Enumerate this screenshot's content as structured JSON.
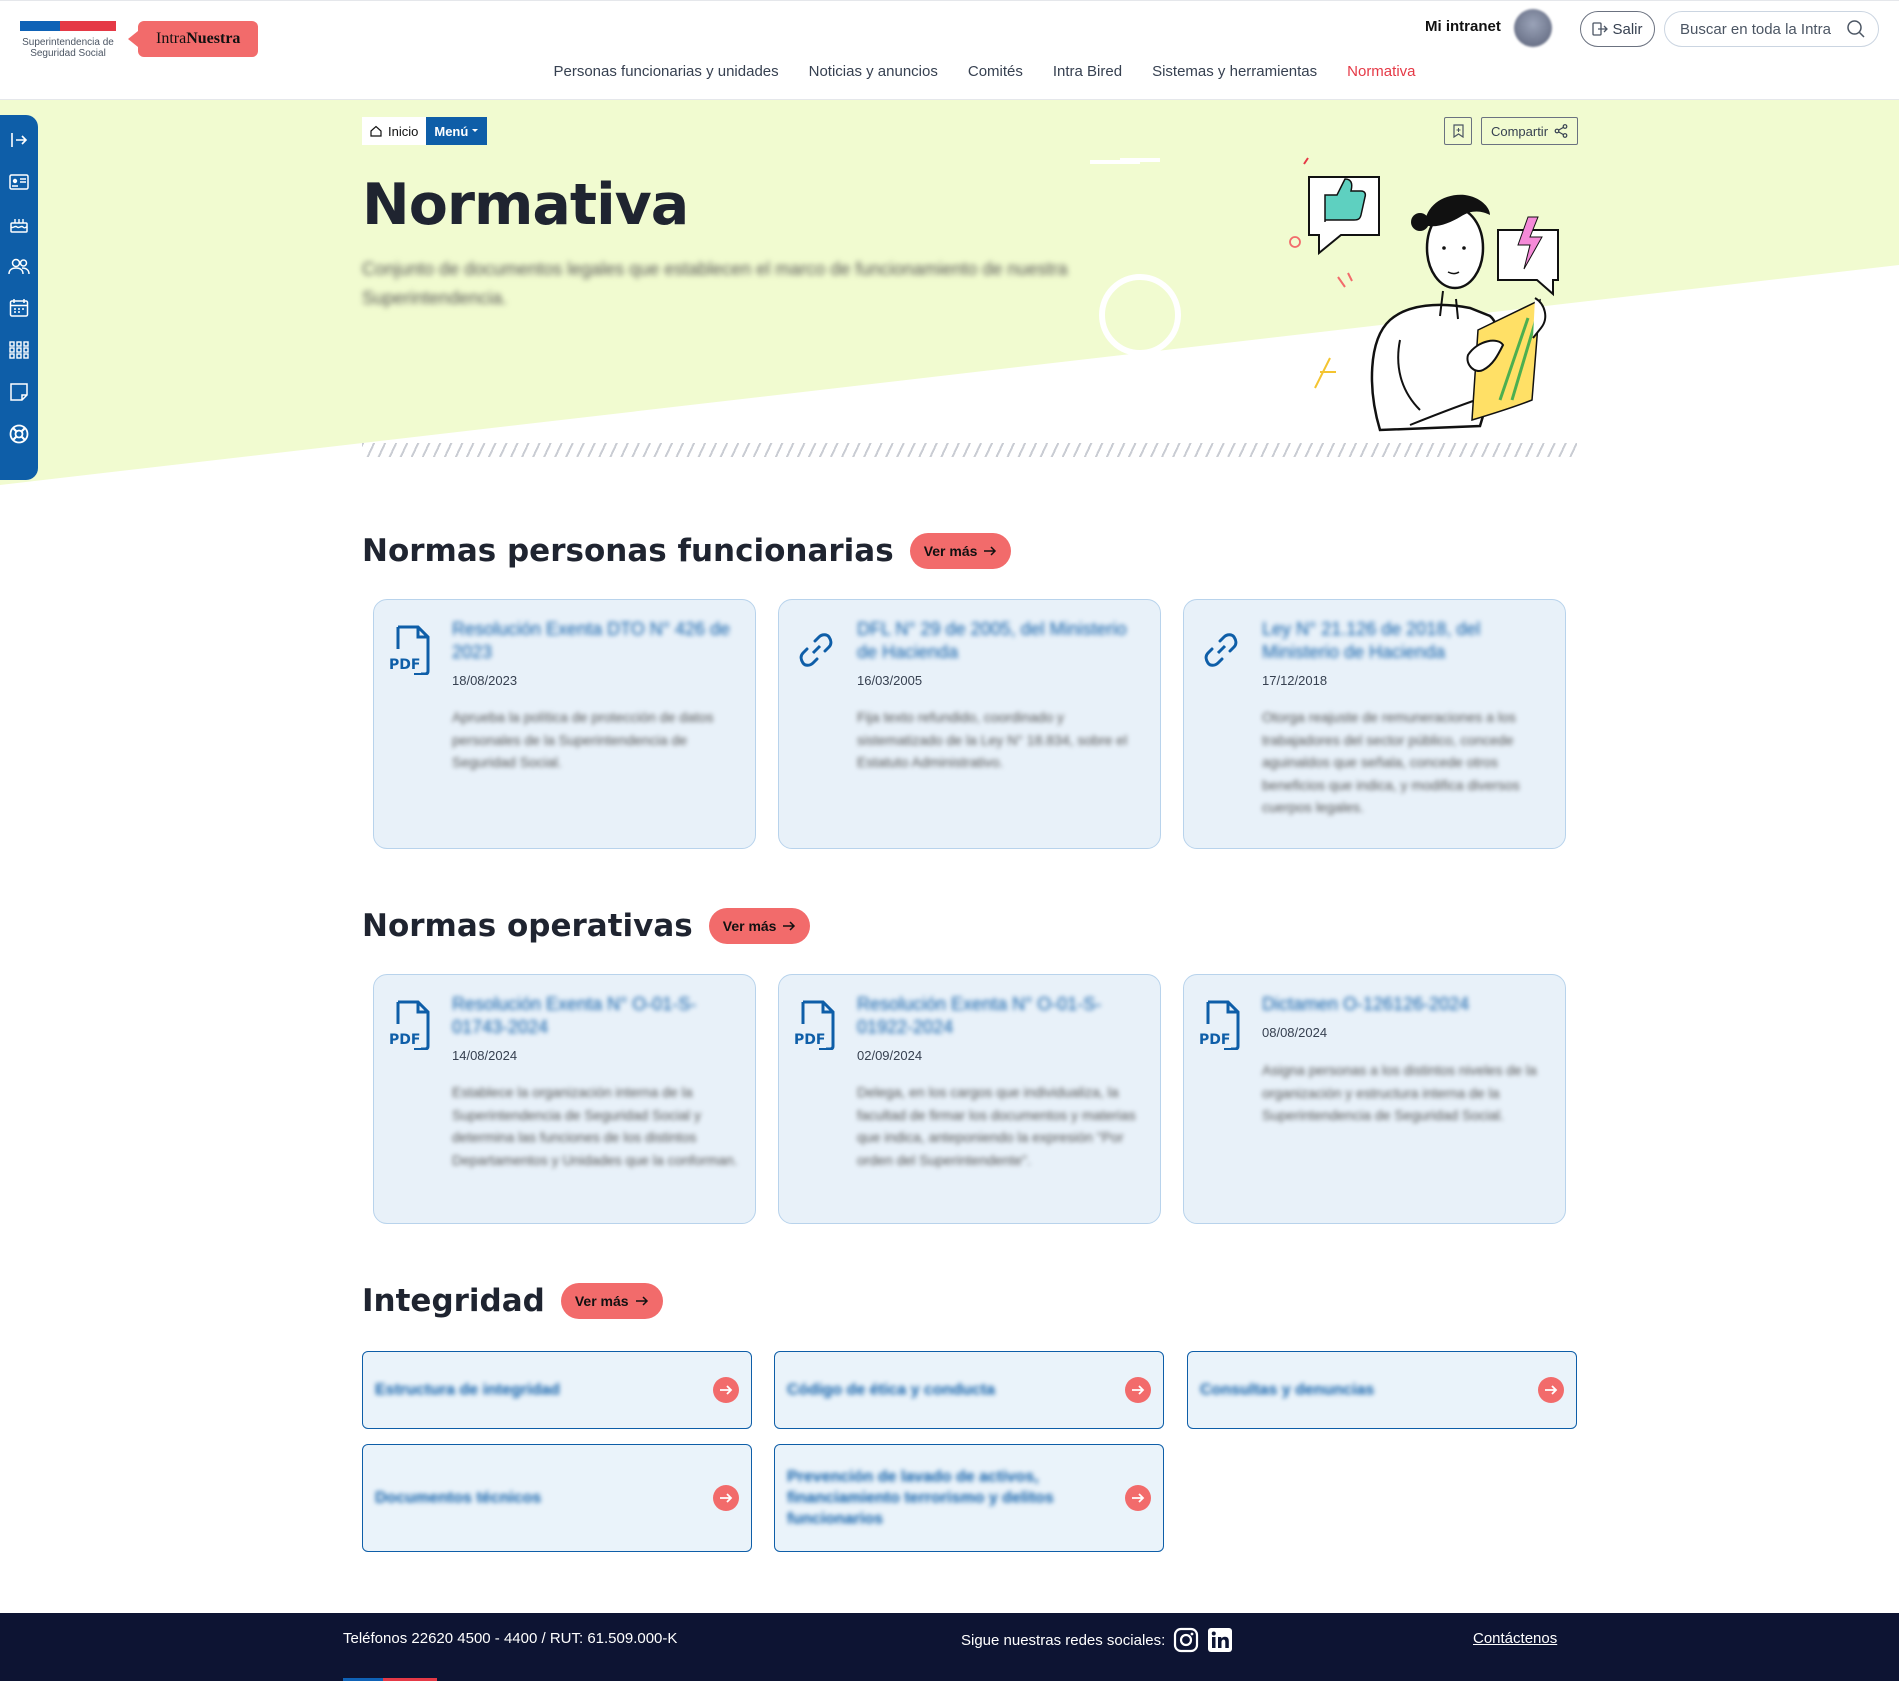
{
  "header": {
    "org_name": "Superintendencia de Seguridad Social",
    "brand_prefix": "Intra",
    "brand_suffix": "Nuestra",
    "mi_intranet": "Mi intranet",
    "salir": "Salir",
    "search_placeholder": "Buscar en toda la Intra"
  },
  "nav": [
    {
      "label": "Personas funcionarias y unidades",
      "active": false
    },
    {
      "label": "Noticias y anuncios",
      "active": false
    },
    {
      "label": "Comités",
      "active": false
    },
    {
      "label": "Intra Bired",
      "active": false
    },
    {
      "label": "Sistemas y herramientas",
      "active": false
    },
    {
      "label": "Normativa",
      "active": true
    }
  ],
  "sidebar_icons": [
    "expand-icon",
    "id-card-icon",
    "cake-icon",
    "people-icon",
    "calendar-icon",
    "apps-grid-icon",
    "notes-icon",
    "help-lifebuoy-icon"
  ],
  "breadcrumb": {
    "home": "Inicio",
    "menu": "Menú"
  },
  "share_label": "Compartir",
  "hero": {
    "title": "Normativa",
    "description": "Conjunto de documentos legales que establecen el marco de funcionamiento de nuestra Superintendencia."
  },
  "sections": {
    "personas": {
      "title": "Normas personas funcionarias",
      "more": "Ver más",
      "cards": [
        {
          "icon": "pdf-icon",
          "title": "Resolución Exenta DTO N° 426 de 2023",
          "date": "18/08/2023",
          "desc": "Aprueba la política de protección de datos personales de la Superintendencia de Seguridad Social."
        },
        {
          "icon": "link-icon",
          "title": "DFL N° 29 de 2005, del Ministerio de Hacienda",
          "date": "16/03/2005",
          "desc": "Fija texto refundido, coordinado y sistematizado de la Ley N° 18.834, sobre el Estatuto Administrativo."
        },
        {
          "icon": "link-icon",
          "title": "Ley N° 21.126 de 2018, del Ministerio de Hacienda",
          "date": "17/12/2018",
          "desc": "Otorga reajuste de remuneraciones a los trabajadores del sector público, concede aguinaldos que señala, concede otros beneficios que indica, y modifica diversos cuerpos legales."
        }
      ]
    },
    "operativas": {
      "title": "Normas operativas",
      "more": "Ver más",
      "cards": [
        {
          "icon": "pdf-icon",
          "title": "Resolución Exenta N° O-01-S-01743-2024",
          "date": "14/08/2024",
          "desc": "Establece la organización interna de la Superintendencia de Seguridad Social y determina las funciones de los distintos Departamentos y Unidades que la conforman."
        },
        {
          "icon": "pdf-icon",
          "title": "Resolución Exenta N° O-01-S-01922-2024",
          "date": "02/09/2024",
          "desc": "Delega, en los cargos que individualiza, la facultad de firmar los documentos y materias que indica, anteponiendo la expresión \"Por orden del Superintendente\"."
        },
        {
          "icon": "pdf-icon",
          "title": "Dictamen O-126126-2024",
          "date": "08/08/2024",
          "desc": "Asigna personas a los distintos niveles de la organización y estructura interna de la Superintendencia de Seguridad Social."
        }
      ]
    },
    "integridad": {
      "title": "Integridad",
      "more": "Ver más",
      "items": [
        "Estructura de integridad",
        "Código de ética y conducta",
        "Consultas y denuncias",
        "Documentos técnicos",
        "Prevención de lavado de activos, financiamiento terrorismo y delitos funcionarios"
      ]
    }
  },
  "pdf_label": "PDF",
  "footer": {
    "phones": "Teléfonos 22620 4500 - 4400 / RUT: 61.509.000-K",
    "social": "Sigue nuestras redes sociales:",
    "contact": "Contáctenos"
  },
  "colors": {
    "primary": "#0e5ea8",
    "accent": "#f26b6b",
    "hero_bg": "#f1fbd0",
    "footer_bg": "#0d1433"
  }
}
